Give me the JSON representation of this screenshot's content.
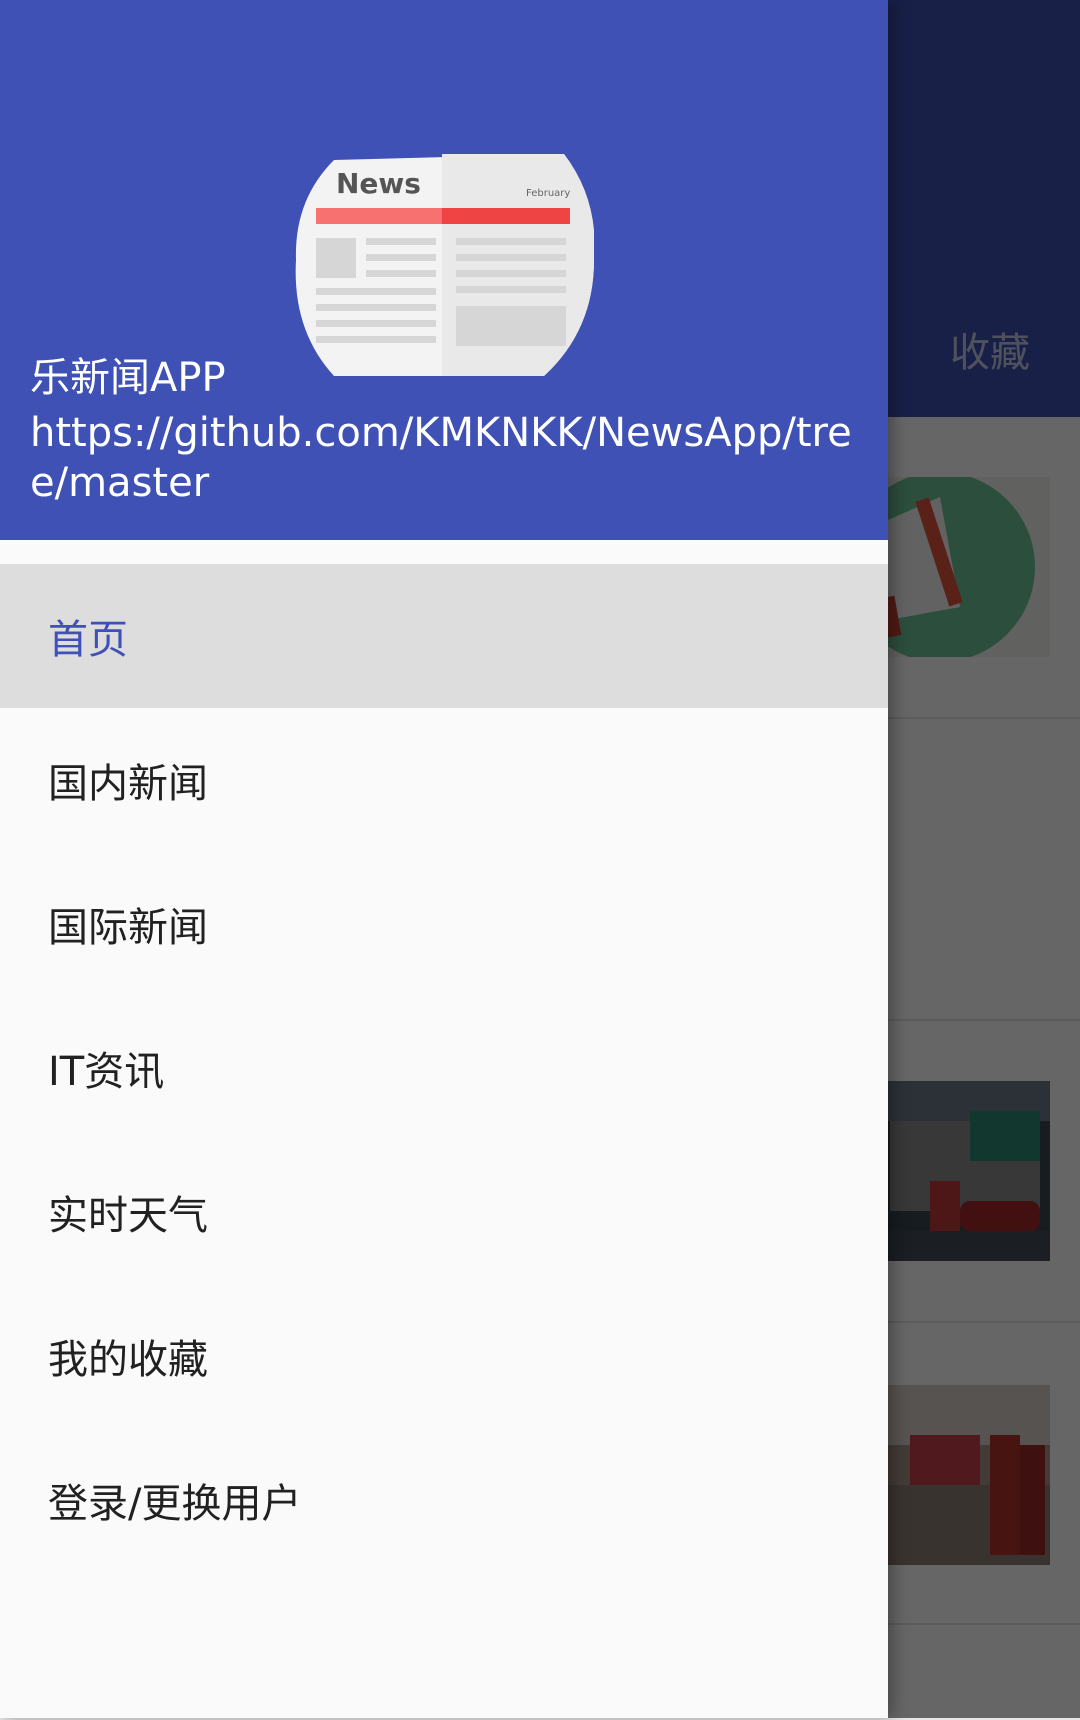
{
  "background": {
    "tab_label": "收藏"
  },
  "drawer": {
    "header": {
      "logo_title": "News",
      "logo_subtitle": "February",
      "app_name": "乐新闻APP",
      "url": "https://github.com/KMKNKK/NewsApp/tree/master"
    },
    "menu": [
      {
        "label": "首页",
        "selected": true
      },
      {
        "label": "国内新闻",
        "selected": false
      },
      {
        "label": "国际新闻",
        "selected": false
      },
      {
        "label": "IT资讯",
        "selected": false
      },
      {
        "label": "实时天气",
        "selected": false
      },
      {
        "label": "我的收藏",
        "selected": false
      },
      {
        "label": "登录/更换用户",
        "selected": false
      }
    ]
  },
  "colors": {
    "primary": "#3f51b5",
    "selected_bg": "#dddddd",
    "drawer_bg": "#fafafa",
    "logo_red": "#f15a5a"
  }
}
